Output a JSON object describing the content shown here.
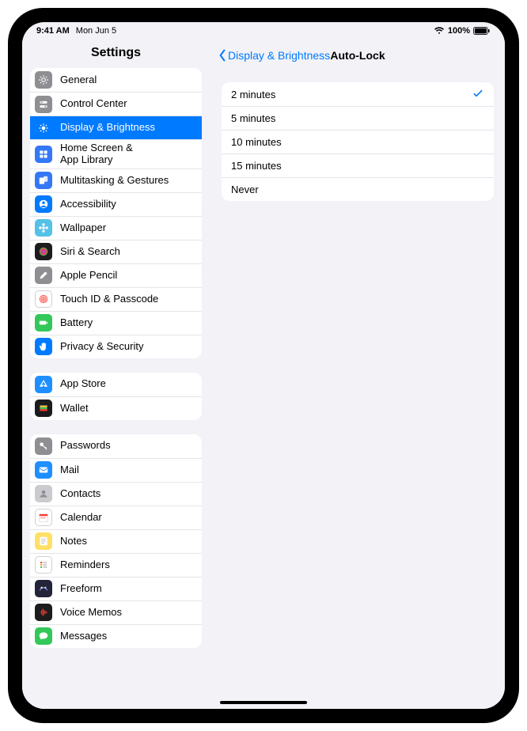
{
  "status": {
    "time": "9:41 AM",
    "date": "Mon Jun 5",
    "battery_pct": "100%"
  },
  "sidebar": {
    "title": "Settings",
    "groups": [
      {
        "items": [
          {
            "id": "general",
            "label": "General",
            "icon": "gear",
            "color": "#8e8e93"
          },
          {
            "id": "control-center",
            "label": "Control Center",
            "icon": "switches",
            "color": "#8e8e93"
          },
          {
            "id": "display",
            "label": "Display & Brightness",
            "icon": "sun",
            "color": "#007aff",
            "selected": true
          },
          {
            "id": "home-screen",
            "label": "Home Screen &\nApp Library",
            "icon": "grid",
            "color": "#3478f6"
          },
          {
            "id": "multitask",
            "label": "Multitasking & Gestures",
            "icon": "rects",
            "color": "#3478f6"
          },
          {
            "id": "accessibility",
            "label": "Accessibility",
            "icon": "person",
            "color": "#007aff"
          },
          {
            "id": "wallpaper",
            "label": "Wallpaper",
            "icon": "flower",
            "color": "#55c1e8"
          },
          {
            "id": "siri",
            "label": "Siri & Search",
            "icon": "siri",
            "color": "#1c1c1e"
          },
          {
            "id": "pencil",
            "label": "Apple Pencil",
            "icon": "pencil",
            "color": "#8e8e93"
          },
          {
            "id": "touchid",
            "label": "Touch ID & Passcode",
            "icon": "finger",
            "color": "#ffffff"
          },
          {
            "id": "battery",
            "label": "Battery",
            "icon": "battery",
            "color": "#34c759"
          },
          {
            "id": "privacy",
            "label": "Privacy & Security",
            "icon": "hand",
            "color": "#007aff"
          }
        ]
      },
      {
        "items": [
          {
            "id": "appstore",
            "label": "App Store",
            "icon": "appstore",
            "color": "#1f8fff"
          },
          {
            "id": "wallet",
            "label": "Wallet",
            "icon": "wallet",
            "color": "#1c1c1e"
          }
        ]
      },
      {
        "items": [
          {
            "id": "passwords",
            "label": "Passwords",
            "icon": "key",
            "color": "#8e8e93"
          },
          {
            "id": "mail",
            "label": "Mail",
            "icon": "mail",
            "color": "#1f8fff"
          },
          {
            "id": "contacts",
            "label": "Contacts",
            "icon": "contacts",
            "color": "#cbcbcf"
          },
          {
            "id": "calendar",
            "label": "Calendar",
            "icon": "calendar",
            "color": "#ffffff"
          },
          {
            "id": "notes",
            "label": "Notes",
            "icon": "notes",
            "color": "#ffe066"
          },
          {
            "id": "reminders",
            "label": "Reminders",
            "icon": "reminders",
            "color": "#ffffff"
          },
          {
            "id": "freeform",
            "label": "Freeform",
            "icon": "freeform",
            "color": "#23233a"
          },
          {
            "id": "voicememos",
            "label": "Voice Memos",
            "icon": "voice",
            "color": "#1c1c1e"
          },
          {
            "id": "messages",
            "label": "Messages",
            "icon": "messages",
            "color": "#34c759"
          }
        ]
      }
    ]
  },
  "detail": {
    "back_label": "Display & Brightness",
    "title": "Auto-Lock",
    "options": [
      {
        "label": "2 minutes",
        "selected": true
      },
      {
        "label": "5 minutes",
        "selected": false
      },
      {
        "label": "10 minutes",
        "selected": false
      },
      {
        "label": "15 minutes",
        "selected": false
      },
      {
        "label": "Never",
        "selected": false
      }
    ]
  }
}
